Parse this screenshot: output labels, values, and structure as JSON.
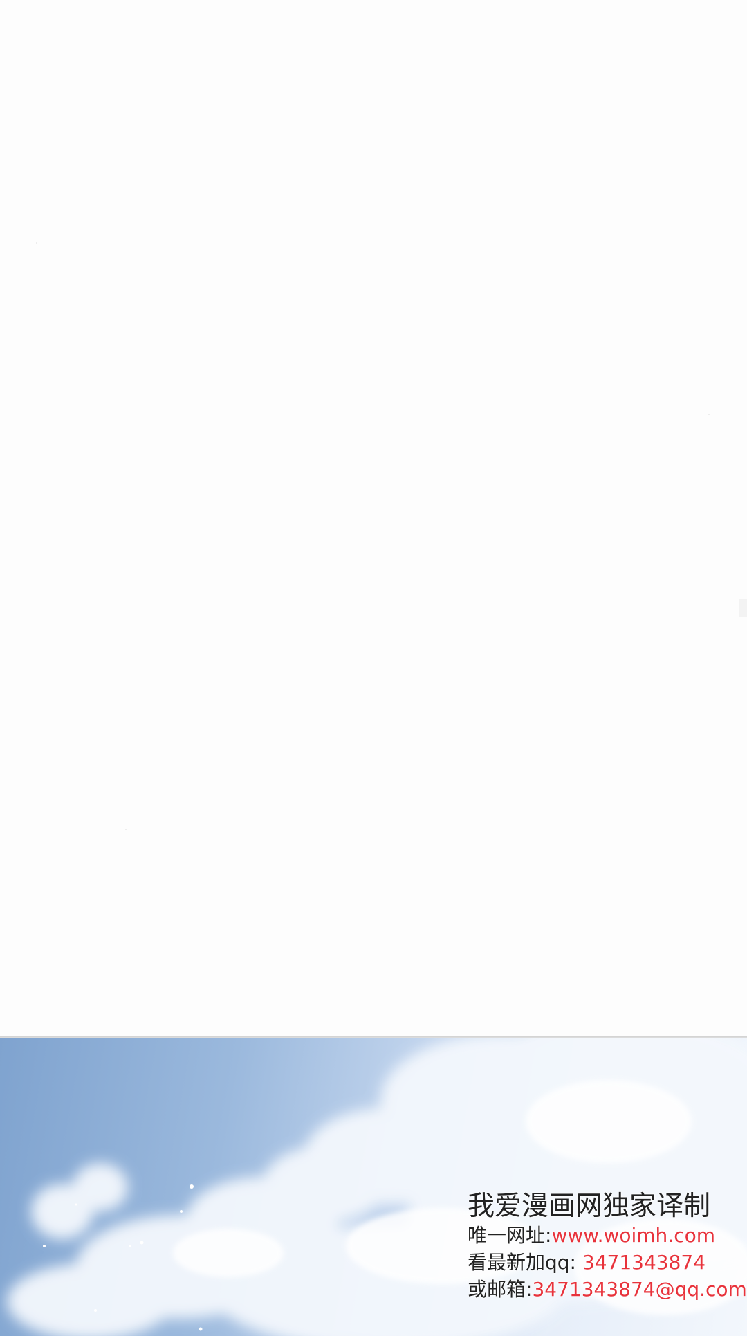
{
  "colors": {
    "page_background": "#fdfdfd",
    "sky_blue": "#7fa3cf",
    "cloud_white": "#f3f7fc",
    "watermark_text": "#222222",
    "watermark_red": "#e8323b"
  },
  "watermark": {
    "title": "我爱漫画网独家译制",
    "url_label": "唯一网址:",
    "url_value": "www.woimh.com",
    "qq_label": "看最新加qq: ",
    "qq_value": "3471343874",
    "email_label": "或邮箱:",
    "email_value": "3471343874@qq.com"
  }
}
